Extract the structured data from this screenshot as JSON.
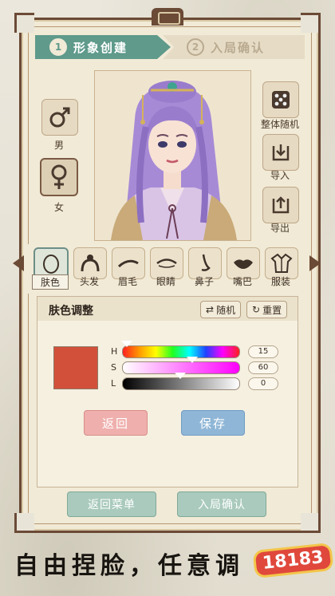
{
  "steps": [
    {
      "num": "1",
      "label": "形象创建",
      "active": true
    },
    {
      "num": "2",
      "label": "入局确认",
      "active": false
    }
  ],
  "gender": {
    "male_label": "男",
    "female_label": "女",
    "selected": "女"
  },
  "right_tools": [
    {
      "label": "整体随机",
      "icon": "dice-icon"
    },
    {
      "label": "导入",
      "icon": "import-icon"
    },
    {
      "label": "导出",
      "icon": "export-icon"
    }
  ],
  "features": [
    {
      "label": "肤色",
      "icon": "face-outline-icon",
      "selected": true
    },
    {
      "label": "头发",
      "icon": "hair-bun-icon"
    },
    {
      "label": "眉毛",
      "icon": "eyebrow-icon"
    },
    {
      "label": "眼睛",
      "icon": "eye-icon"
    },
    {
      "label": "鼻子",
      "icon": "nose-icon"
    },
    {
      "label": "嘴巴",
      "icon": "lips-icon"
    },
    {
      "label": "服装",
      "icon": "robe-icon"
    }
  ],
  "panel": {
    "title": "肤色调整",
    "random_label": "随机",
    "reset_label": "重置",
    "swatch_color": "#d2503a",
    "sliders": [
      {
        "label": "H",
        "value": "15",
        "fraction": 0.04
      },
      {
        "label": "S",
        "value": "60",
        "fraction": 0.6
      },
      {
        "label": "L",
        "value": "0",
        "fraction": 0.5
      }
    ],
    "back_label": "返回",
    "save_label": "保存"
  },
  "footer": {
    "menu_label": "返回菜单",
    "confirm_label": "入局确认"
  },
  "caption": "自由捏脸，任意调",
  "watermark": "18183",
  "colors": {
    "accent_teal": "#5f9a8b",
    "frame_brown": "#6b4a36",
    "back_pink": "#efb0ad",
    "save_blue": "#8fb6d6",
    "hair_purple": "#a78ad6"
  }
}
